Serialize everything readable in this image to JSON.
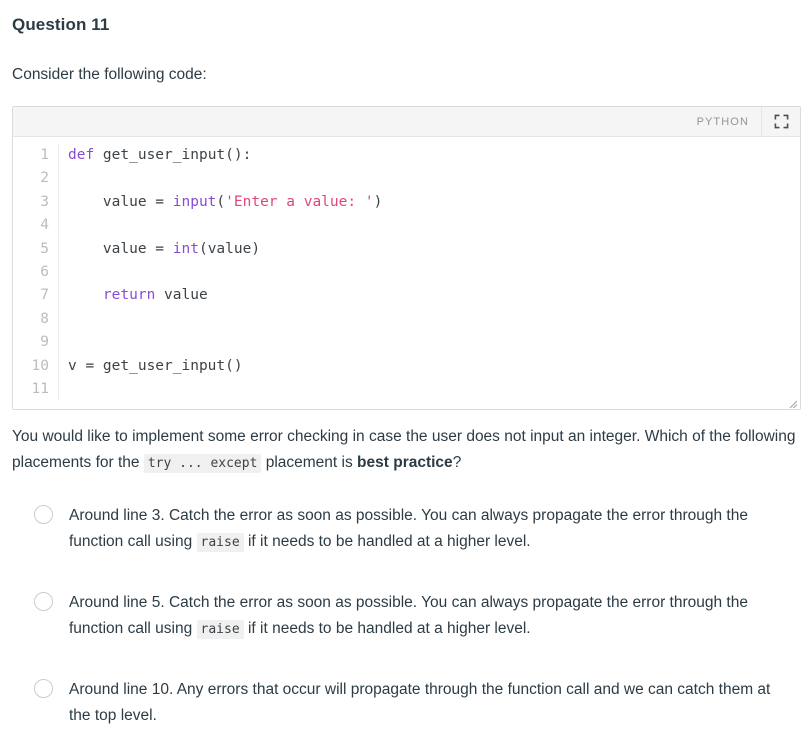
{
  "question": {
    "title": "Question 11",
    "intro": "Consider the following code:",
    "body_part1": "You would like to implement some error checking in case the user does not input an integer.  Which of the following placements for the ",
    "body_code": "try ... except",
    "body_part2": " placement is ",
    "body_bold": "best practice",
    "body_part3": "?"
  },
  "code_block": {
    "language_label": "PYTHON",
    "expand_icon": "fullscreen-icon",
    "resize_icon": "resize-handle-icon",
    "lines": [
      {
        "n": "1",
        "tokens": [
          {
            "t": "def",
            "c": "kw"
          },
          {
            "t": " get_user_input():",
            "c": "plain"
          }
        ]
      },
      {
        "n": "2",
        "tokens": []
      },
      {
        "n": "3",
        "tokens": [
          {
            "t": "    value = ",
            "c": "plain"
          },
          {
            "t": "input",
            "c": "fn"
          },
          {
            "t": "(",
            "c": "plain"
          },
          {
            "t": "'Enter a value: '",
            "c": "str"
          },
          {
            "t": ")",
            "c": "plain"
          }
        ]
      },
      {
        "n": "4",
        "tokens": []
      },
      {
        "n": "5",
        "tokens": [
          {
            "t": "    value = ",
            "c": "plain"
          },
          {
            "t": "int",
            "c": "fn"
          },
          {
            "t": "(value)",
            "c": "plain"
          }
        ]
      },
      {
        "n": "6",
        "tokens": []
      },
      {
        "n": "7",
        "tokens": [
          {
            "t": "    ",
            "c": "plain"
          },
          {
            "t": "return",
            "c": "kw"
          },
          {
            "t": " value",
            "c": "plain"
          }
        ]
      },
      {
        "n": "8",
        "tokens": []
      },
      {
        "n": "9",
        "tokens": []
      },
      {
        "n": "10",
        "tokens": [
          {
            "t": "v = get_user_input()",
            "c": "plain"
          }
        ]
      },
      {
        "n": "11",
        "tokens": []
      }
    ]
  },
  "answers": [
    {
      "id": "answer-line-3",
      "part1": "Around line 3.  Catch the error as soon as possible.  You can always propagate the error through the function call using ",
      "code": "raise",
      "part2": " if it needs to be handled at a higher level.",
      "selected": false
    },
    {
      "id": "answer-line-5",
      "part1": "Around line 5.  Catch the error as soon as possible.  You can always propagate the error through the function call using ",
      "code": "raise",
      "part2": " if it needs to be handled at a higher level.",
      "selected": false
    },
    {
      "id": "answer-line-10",
      "part1": "Around line 10.  Any errors that occur will propagate through the function call and we can catch them at the top level.",
      "code": "",
      "part2": "",
      "selected": false
    }
  ],
  "colors": {
    "text": "#2d3b45",
    "keyword": "#8a4bd3",
    "string": "#e0457b",
    "code_plain": "#3d4347",
    "line_number": "#b9bdc0",
    "border": "#d7dce0",
    "header_bg": "#f5f5f5",
    "inline_code_bg": "#f0f0f0",
    "radio_border": "#c7cdd1"
  }
}
